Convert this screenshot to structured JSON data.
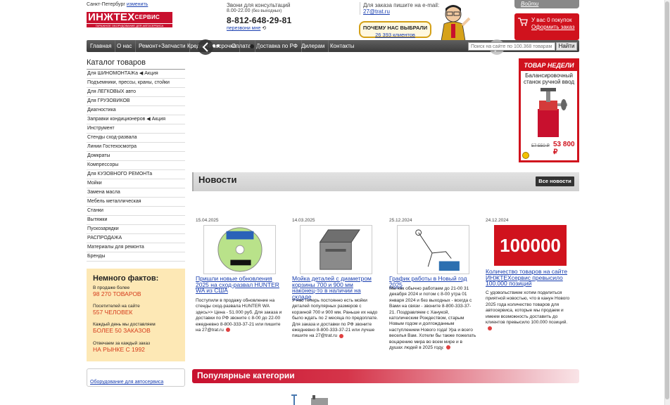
{
  "header": {
    "city": "Санкт-Петербург",
    "city_change": "изменить",
    "logo_main": "ИНЖТЕХ",
    "logo_suffix": "СЕРВИС",
    "logo_tagline": "ГАРАЖНОЕ ОБОРУДОВАНИЕ ДЛЯ АВТОСЕРВИСА",
    "call_text": "Звони для консультаций",
    "call_hours": "8.00-22.00",
    "call_hours_note": "(без выходных)",
    "phone": "8-812-648-29-81",
    "callback": "перезвони мне",
    "order_text": "Для заказа пишите на e-mail:",
    "order_email": "27@trat.ru",
    "why_title": "ПОЧЕМУ НАС ВЫБРАЛИ",
    "why_count": "26 393 клиентов",
    "login": "Войти",
    "cart_line1": "У вас 0 покупок",
    "cart_line2": "Оформить заказ"
  },
  "nav": {
    "items": [
      "Главная",
      "О нас",
      "Ремонт+Запчасти",
      "Кредит+Рассрочка",
      "Оплата",
      "Доставка по РФ",
      "Дилерам",
      "Контакты"
    ],
    "search_placeholder": "Поиск на сайте по 100.368 товарам",
    "search_button": "Найти"
  },
  "catalog": {
    "title": "Каталог товаров",
    "items": [
      "Для ШИНОМОНТАЖа ◀ Акция",
      "Подъемники, прессы, краны, стойки",
      "Для ЛЕГКОВЫХ авто",
      "Для ГРУЗОВИКОВ",
      "Диагностика",
      "Заправки кондиционеров ◀ Акция",
      "Инструмент",
      "Стенды сход-развала",
      "Линии Гостехосмотра",
      "Домкраты",
      "Компрессоры",
      "Для КУЗОВНОГО РЕМОНТа",
      "Мойки",
      "Замена масла",
      "Мебель металлическая",
      "Станки",
      "Вытяжки",
      "Пускозарядки",
      "РАСПРОДАЖА",
      "Материалы для ремонта",
      "Бренды"
    ]
  },
  "facts": {
    "title": "Немного фактов:",
    "items": [
      {
        "label": "В продаже более",
        "value": "98 270 ТОВАРОВ"
      },
      {
        "label": "Посетителей на сайте",
        "value": "557 ЧЕЛОВЕК"
      },
      {
        "label": "Каждый день мы доставляем",
        "value": "БОЛЕЕ 50 ЗАКАЗОВ"
      },
      {
        "label": "Отвечаем за каждый заказ",
        "value": "НА РЫНКЕ С 1992"
      }
    ]
  },
  "equip_link": "Оборудование для автосервиса",
  "week_product": {
    "header": "ТОВАР НЕДЕЛИ",
    "name": "Балансировочный станок ручной ввод",
    "old_price": "57 550 ₽",
    "new_price": "53 800 ₽"
  },
  "news": {
    "title": "Новости",
    "all_button": "Все новости",
    "items": [
      {
        "date": "15.04.2025",
        "title": "Пришли новые обновления 2025 на сход-развал HUNTER WA из США",
        "text": "Поступили в продажу обновление на стенды сход-развала HUNTER WA здесь>> Цена - 51.000 руб. Для заказа и доставки по РФ звоните с 8-00 до 22-00 ежедневно 8-800-333-37-21 или пишите на  27@trat.ru"
      },
      {
        "date": "14.03.2025",
        "title": "Мойка деталей с диаметром корзины 700 и 900 мм наконец-то в наличии на складе",
        "text": "У нас теперь постоянно есть мойки деталей популярных размеров с корзиной 700 и 900 мм. Раньше их надо было ждать по 2 месяца по предоплате. Для заказа и доставки по РФ звоните ежедневно 8-800-333-37-21 или лучше пишите на 27@trat.ru"
      },
      {
        "date": "25.12.2024",
        "title": "График работы в Новый год 2025",
        "text": "Мы как обычно работаем до 21-00 31 декабря 2024 и потом с 8-00 утра 01 января 2024 и без выходных - всегда с Вами на связи - звоните 8-800-333-37-21. Поздравляем с Ханукой, католическим Рождеством, старым Новым годом и долгожданным наступлением Нового года! Ура и всего веселья Вам. Хотели бы также пожелать воцарению мира во всем мире и в душах людей в 2025 году."
      },
      {
        "date": "24.12.2024",
        "title": "Количество товаров на сайте ИНЖТЕХсервис превысило 100.000 позиций",
        "text": "С удовольствием хотим поделиться приятной новостью, что в канун Нового 2025 года количество товаров для автосервиса, которые мы продаем и имеем возможность доставить до клиентов превысило 100.000 позиций.",
        "badge": "100000"
      }
    ]
  },
  "popular_title": "Популярные категории",
  "colors": {
    "brand_red": "#c8102e",
    "nav_dark": "#3b3b3b",
    "link_blue": "#1a3fb0",
    "facts_bg": "#fde8b5"
  }
}
